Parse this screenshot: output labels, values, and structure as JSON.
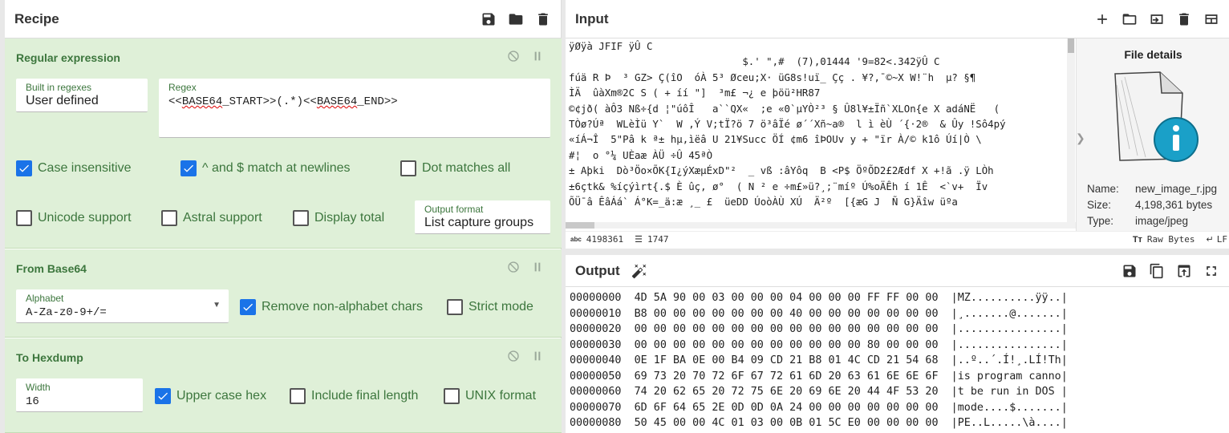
{
  "recipe": {
    "title": "Recipe",
    "ops": [
      {
        "name": "Regular expression",
        "builtin_label": "Built in regexes",
        "builtin_value": "User defined",
        "regex_label": "Regex",
        "regex_parts": [
          "<<",
          "BASE64",
          "_START>>(.*)<<",
          "BASE64",
          "_END>>"
        ],
        "checkboxes": [
          {
            "label": "Case insensitive",
            "checked": true
          },
          {
            "label": "^ and $ match at newlines",
            "checked": true
          },
          {
            "label": "Dot matches all",
            "checked": false
          },
          {
            "label": "Unicode support",
            "checked": false
          },
          {
            "label": "Astral support",
            "checked": false
          },
          {
            "label": "Display total",
            "checked": false
          }
        ],
        "output_format_label": "Output format",
        "output_format_value": "List capture groups"
      },
      {
        "name": "From Base64",
        "alphabet_label": "Alphabet",
        "alphabet_value": "A-Za-z0-9+/=",
        "checkboxes": [
          {
            "label": "Remove non-alphabet chars",
            "checked": true
          },
          {
            "label": "Strict mode",
            "checked": false
          }
        ]
      },
      {
        "name": "To Hexdump",
        "width_label": "Width",
        "width_value": "16",
        "checkboxes": [
          {
            "label": "Upper case hex",
            "checked": true
          },
          {
            "label": "Include final length",
            "checked": false
          },
          {
            "label": "UNIX format",
            "checked": false
          }
        ]
      }
    ]
  },
  "input": {
    "title": "Input",
    "lines": [
      "ÿØÿà JFIF ÿÛ C                          ",
      "                             $.' \",#  (7),01444 '9=82<.342ÿÛ C                    ",
      "fúä R Þ  ³ GZ> Ç(îO  óÀ 5³ Øceu;X· üG8s!uï_ Çç . ¥?,¯©~X W!¨h  µ? §¶",
      "ÌÄ  ûàXm®2C S ( + íí \"]  ³m£ ¬¿ e þöü²HR87 ",
      "©¢jð( àÔ3 Nß÷{d ¦\"úôÎ   a``QX«  ;e «0`µYÒ²³ § Û8l¥±Ïñ`XLOn{e X adáNË   (",
      "TÒø?Úª  WLèÌü Y`  W ,Ý V;tÏ?ö 7 ö³âÏé ø´´Xñ~a®  l ì èÙ ´{·2®  & Ûy !Sô4pý",
      "«íÁ¬Î  5\"Pâ k ª± hµ,ìëâ U 21¥Succ ÖÍ ¢m6 îÞOUv y + \"ïr À/© k1ô Úí|Ò \\",
      "#¦  o °¼ UÈaæ ÀÜ ÷Û 45ªÒ ",
      "± Aþki  Dò³Öo×ÕK{I¿ýXæµÉxD\"²  _ vß :âYôq  B <P$ ÖºÕD2£2Ædf X +!ã .ÿ LÒh ",
      "±6çtk& %íçýìrt{.$ È ûç, ø°  ( N ² e ÷m£»ü?¸;¨míº Ú%oÄÊh í 1Ê  <`v+  Ïv ",
      "ÕÜ¯â ÊâÁá` Á°K=_ä:æ ¸_ £  üeDD ÚoòÀÙ XÚ  Ä²º  [{æG J  Ñ G}Äîw üºa  "
    ],
    "length": "4198361",
    "lines_count": "1747",
    "raw_bytes": "Raw Bytes",
    "lf": "LF"
  },
  "file_details": {
    "title": "File details",
    "name_label": "Name:",
    "name_value": "new_image_r.jpg",
    "size_label": "Size:",
    "size_value": "4,198,361 bytes",
    "type_label": "Type:",
    "type_value": "image/jpeg"
  },
  "output": {
    "title": "Output",
    "rows": [
      "00000000  4D 5A 90 00 03 00 00 00 04 00 00 00 FF FF 00 00  |MZ..........ÿÿ..|",
      "00000010  B8 00 00 00 00 00 00 00 40 00 00 00 00 00 00 00  |¸.......@.......|",
      "00000020  00 00 00 00 00 00 00 00 00 00 00 00 00 00 00 00  |................|",
      "00000030  00 00 00 00 00 00 00 00 00 00 00 00 80 00 00 00  |................|",
      "00000040  0E 1F BA 0E 00 B4 09 CD 21 B8 01 4C CD 21 54 68  |..º..´.Í!¸.LÍ!Th|",
      "00000050  69 73 20 70 72 6F 67 72 61 6D 20 63 61 6E 6E 6F  |is program canno|",
      "00000060  74 20 62 65 20 72 75 6E 20 69 6E 20 44 4F 53 20  |t be run in DOS |",
      "00000070  6D 6F 64 65 2E 0D 0D 0A 24 00 00 00 00 00 00 00  |mode....$.......|",
      "00000080  50 45 00 00 4C 01 03 00 0B 01 5C E0 00 00 00 00  |PE..L.....\\à....|"
    ]
  },
  "colors": {
    "accent": "#1a73e8",
    "op_bg": "#dff0d8",
    "op_text": "#3c763d",
    "special_char": "#d00000"
  }
}
